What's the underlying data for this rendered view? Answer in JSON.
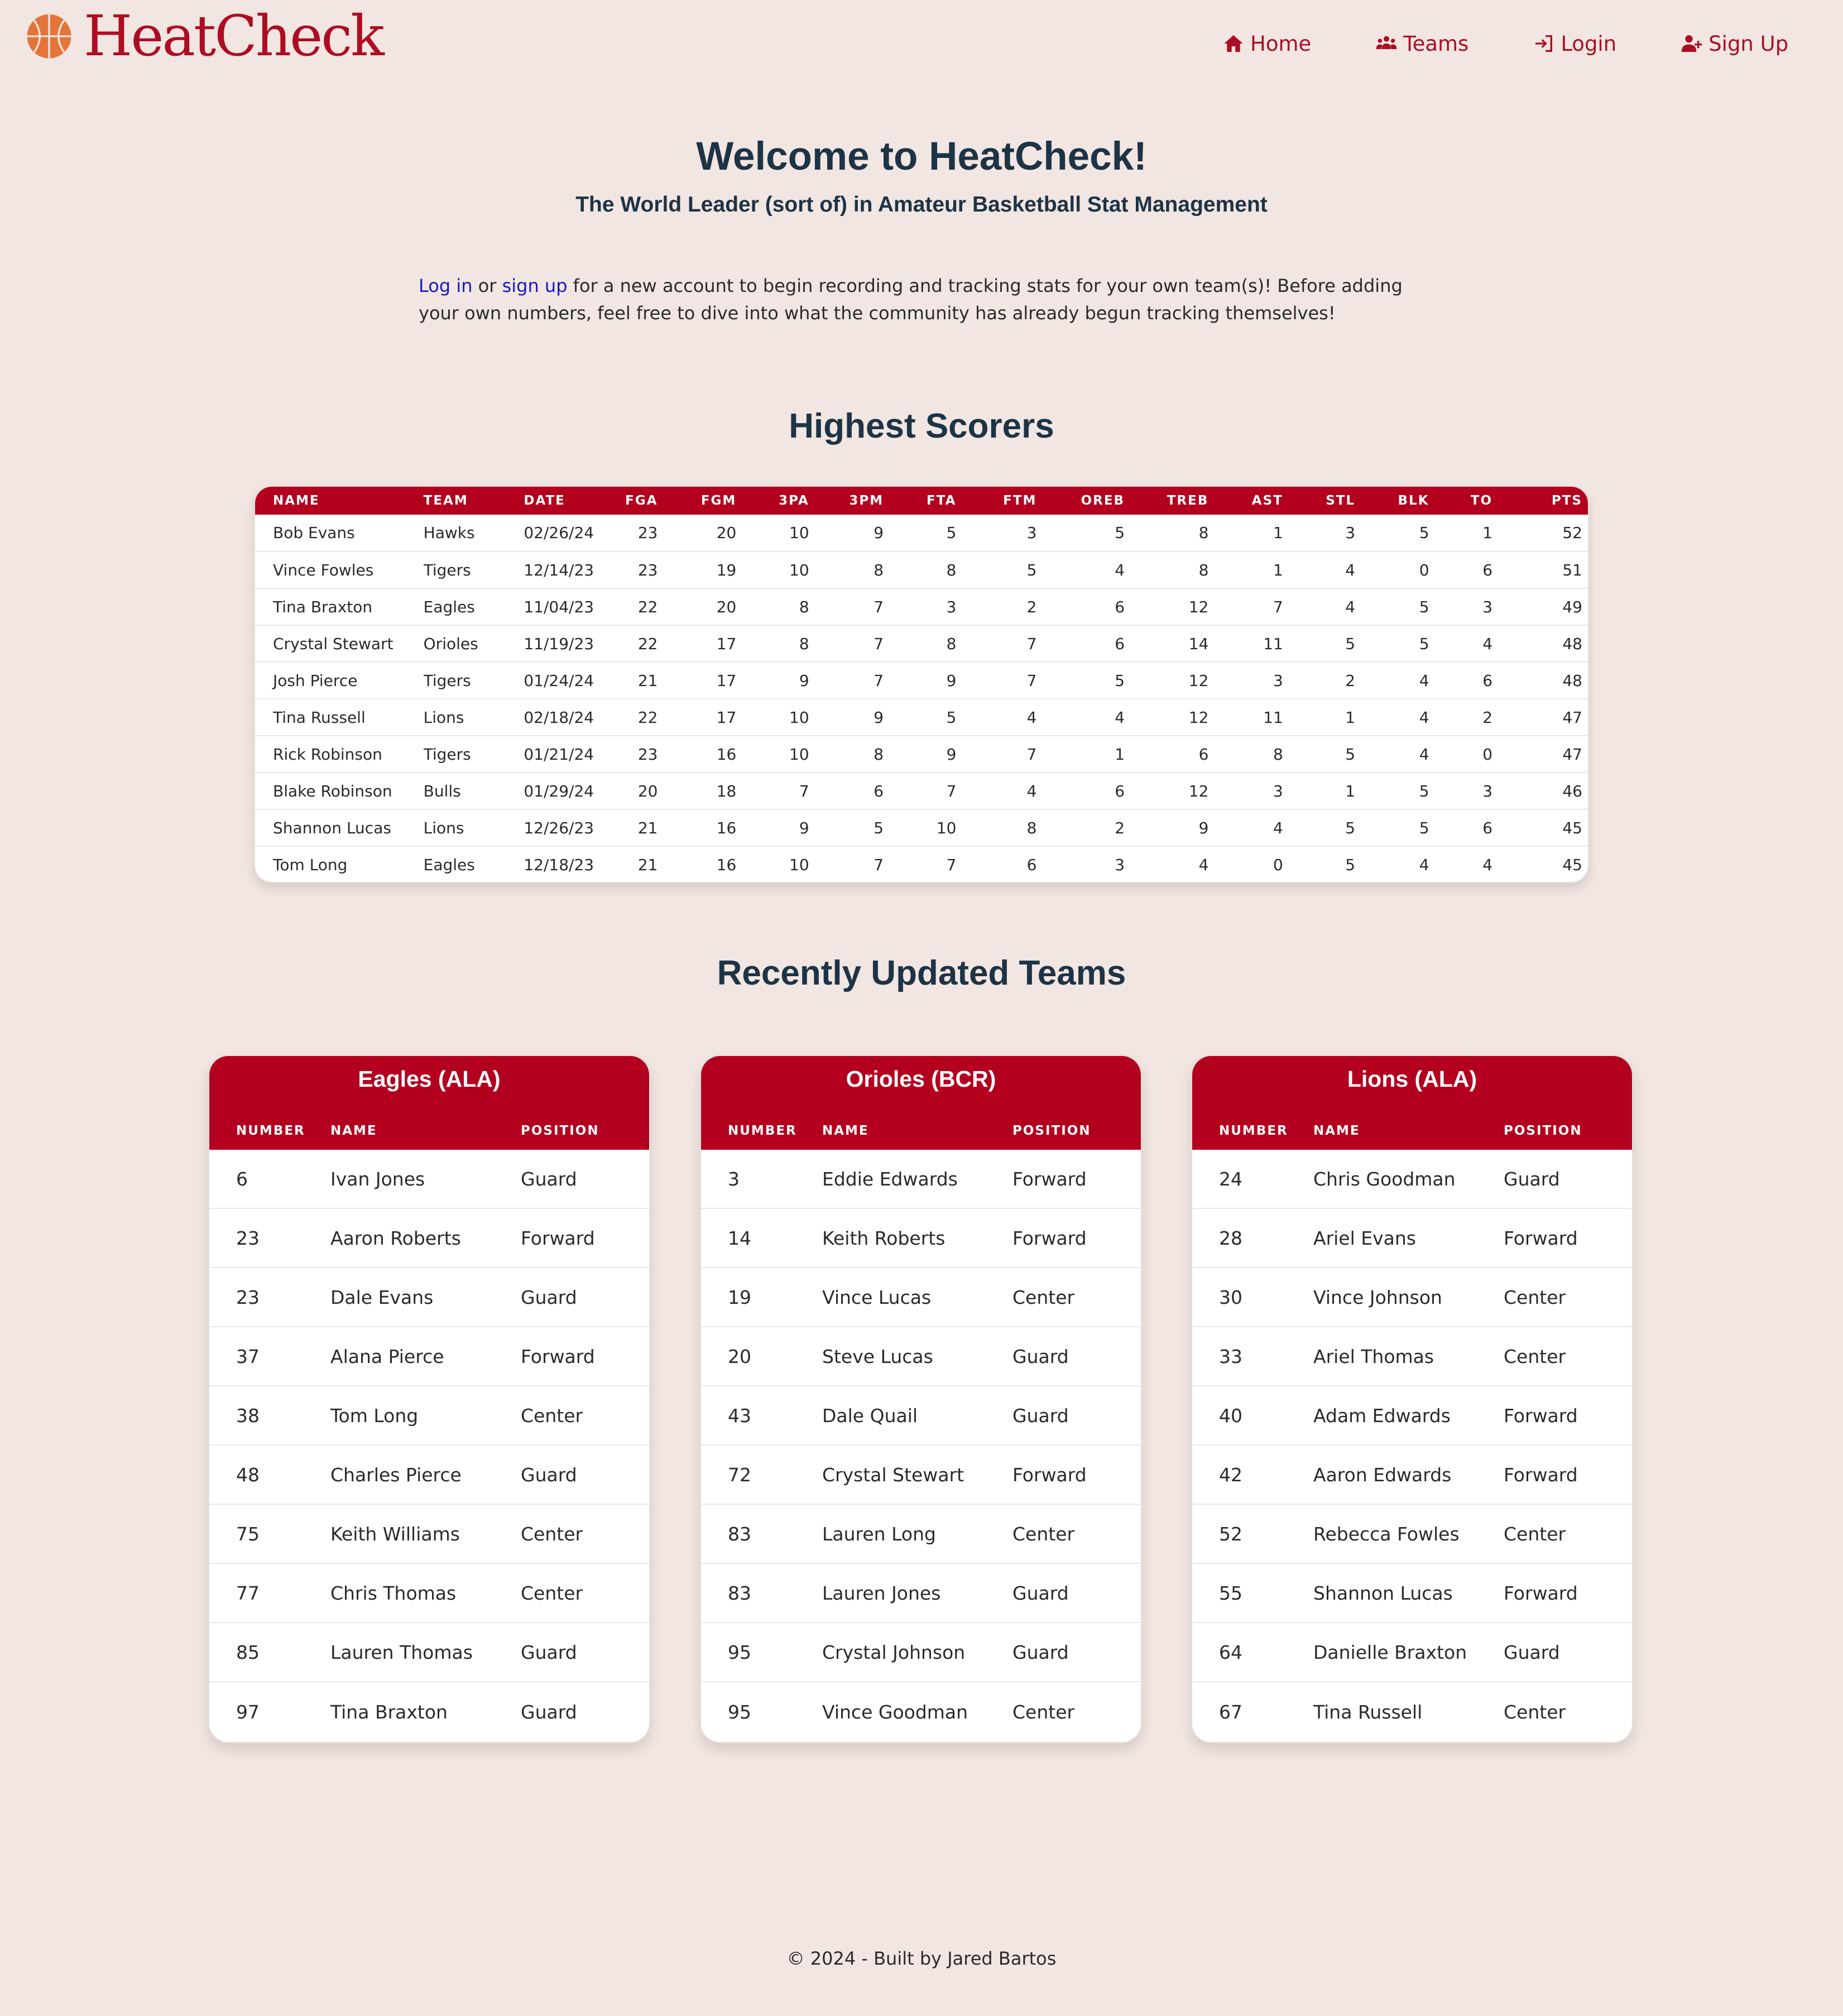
{
  "brand": {
    "name": "HeatCheck"
  },
  "nav": [
    {
      "label": "Home",
      "icon": "home-icon"
    },
    {
      "label": "Teams",
      "icon": "teams-icon"
    },
    {
      "label": "Login",
      "icon": "login-icon"
    },
    {
      "label": "Sign Up",
      "icon": "user-plus-icon"
    }
  ],
  "hero": {
    "title": "Welcome to HeatCheck!",
    "subtitle": "The World Leader (sort of) in Amateur Basketball Stat Management",
    "login_link": "Log in",
    "or_text": " or ",
    "signup_link": "sign up",
    "body": " for a new account to begin recording and tracking stats for your own team(s)! Before adding your own numbers, feel free to dive into what the community has already begun tracking themselves!"
  },
  "scorers": {
    "title": "Highest Scorers",
    "columns": [
      "NAME",
      "TEAM",
      "DATE",
      "FGA",
      "FGM",
      "3PA",
      "3PM",
      "FTA",
      "FTM",
      "OREB",
      "TREB",
      "AST",
      "STL",
      "BLK",
      "TO",
      "PTS"
    ],
    "rows": [
      [
        "Bob Evans",
        "Hawks",
        "02/26/24",
        "23",
        "20",
        "10",
        "9",
        "5",
        "3",
        "5",
        "8",
        "1",
        "3",
        "5",
        "1",
        "52"
      ],
      [
        "Vince Fowles",
        "Tigers",
        "12/14/23",
        "23",
        "19",
        "10",
        "8",
        "8",
        "5",
        "4",
        "8",
        "1",
        "4",
        "0",
        "6",
        "51"
      ],
      [
        "Tina Braxton",
        "Eagles",
        "11/04/23",
        "22",
        "20",
        "8",
        "7",
        "3",
        "2",
        "6",
        "12",
        "7",
        "4",
        "5",
        "3",
        "49"
      ],
      [
        "Crystal Stewart",
        "Orioles",
        "11/19/23",
        "22",
        "17",
        "8",
        "7",
        "8",
        "7",
        "6",
        "14",
        "11",
        "5",
        "5",
        "4",
        "48"
      ],
      [
        "Josh Pierce",
        "Tigers",
        "01/24/24",
        "21",
        "17",
        "9",
        "7",
        "9",
        "7",
        "5",
        "12",
        "3",
        "2",
        "4",
        "6",
        "48"
      ],
      [
        "Tina Russell",
        "Lions",
        "02/18/24",
        "22",
        "17",
        "10",
        "9",
        "5",
        "4",
        "4",
        "12",
        "11",
        "1",
        "4",
        "2",
        "47"
      ],
      [
        "Rick Robinson",
        "Tigers",
        "01/21/24",
        "23",
        "16",
        "10",
        "8",
        "9",
        "7",
        "1",
        "6",
        "8",
        "5",
        "4",
        "0",
        "47"
      ],
      [
        "Blake Robinson",
        "Bulls",
        "01/29/24",
        "20",
        "18",
        "7",
        "6",
        "7",
        "4",
        "6",
        "12",
        "3",
        "1",
        "5",
        "3",
        "46"
      ],
      [
        "Shannon Lucas",
        "Lions",
        "12/26/23",
        "21",
        "16",
        "9",
        "5",
        "10",
        "8",
        "2",
        "9",
        "4",
        "5",
        "5",
        "6",
        "45"
      ],
      [
        "Tom Long",
        "Eagles",
        "12/18/23",
        "21",
        "16",
        "10",
        "7",
        "7",
        "6",
        "3",
        "4",
        "0",
        "5",
        "4",
        "4",
        "45"
      ]
    ]
  },
  "teams_section": {
    "title": "Recently Updated Teams",
    "columns": [
      "NUMBER",
      "NAME",
      "POSITION"
    ],
    "teams": [
      {
        "name": "Eagles (ALA)",
        "players": [
          [
            "6",
            "Ivan Jones",
            "Guard"
          ],
          [
            "23",
            "Aaron Roberts",
            "Forward"
          ],
          [
            "23",
            "Dale Evans",
            "Guard"
          ],
          [
            "37",
            "Alana Pierce",
            "Forward"
          ],
          [
            "38",
            "Tom Long",
            "Center"
          ],
          [
            "48",
            "Charles Pierce",
            "Guard"
          ],
          [
            "75",
            "Keith Williams",
            "Center"
          ],
          [
            "77",
            "Chris Thomas",
            "Center"
          ],
          [
            "85",
            "Lauren Thomas",
            "Guard"
          ],
          [
            "97",
            "Tina Braxton",
            "Guard"
          ]
        ]
      },
      {
        "name": "Orioles (BCR)",
        "players": [
          [
            "3",
            "Eddie Edwards",
            "Forward"
          ],
          [
            "14",
            "Keith Roberts",
            "Forward"
          ],
          [
            "19",
            "Vince Lucas",
            "Center"
          ],
          [
            "20",
            "Steve Lucas",
            "Guard"
          ],
          [
            "43",
            "Dale Quail",
            "Guard"
          ],
          [
            "72",
            "Crystal Stewart",
            "Forward"
          ],
          [
            "83",
            "Lauren Long",
            "Center"
          ],
          [
            "83",
            "Lauren Jones",
            "Guard"
          ],
          [
            "95",
            "Crystal Johnson",
            "Guard"
          ],
          [
            "95",
            "Vince Goodman",
            "Center"
          ]
        ]
      },
      {
        "name": "Lions (ALA)",
        "players": [
          [
            "24",
            "Chris Goodman",
            "Guard"
          ],
          [
            "28",
            "Ariel Evans",
            "Forward"
          ],
          [
            "30",
            "Vince Johnson",
            "Center"
          ],
          [
            "33",
            "Ariel Thomas",
            "Center"
          ],
          [
            "40",
            "Adam Edwards",
            "Forward"
          ],
          [
            "42",
            "Aaron Edwards",
            "Forward"
          ],
          [
            "52",
            "Rebecca Fowles",
            "Center"
          ],
          [
            "55",
            "Shannon Lucas",
            "Forward"
          ],
          [
            "64",
            "Danielle Braxton",
            "Guard"
          ],
          [
            "67",
            "Tina Russell",
            "Center"
          ]
        ]
      }
    ]
  },
  "footer": {
    "text": "© 2024 - Built by Jared Bartos"
  },
  "colors": {
    "background": "#f1e6e1",
    "accent": "#b3001e",
    "heading": "#1d3346",
    "link": "#1717c6",
    "ball": "#e5743a"
  }
}
